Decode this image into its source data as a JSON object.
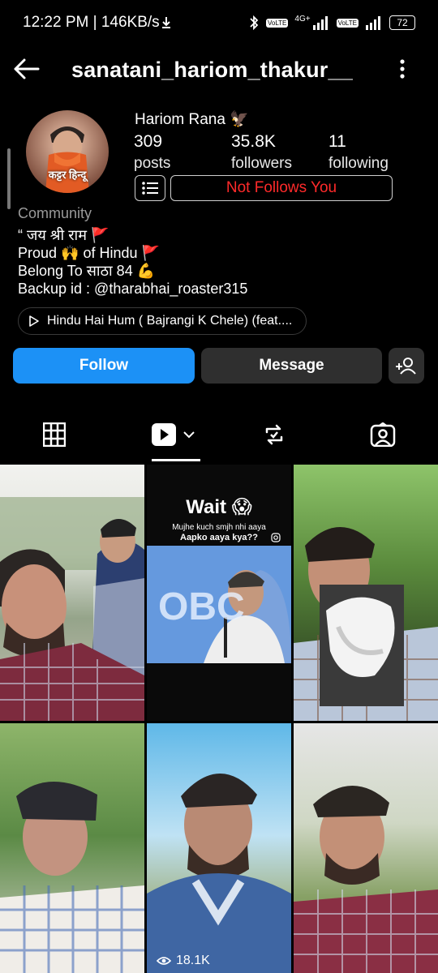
{
  "status": {
    "time_speed": "12:22 PM | 146KB/s",
    "battery": "72",
    "network": "4G+",
    "lte_tag": "Vo LTE"
  },
  "profile": {
    "username": "sanatani_hariom_thakur__",
    "display_name": "Hariom Rana 🦅",
    "avatar_caption": "कट्टर हिन्दू",
    "stats": {
      "posts": {
        "num": "309",
        "label": "posts"
      },
      "followers": {
        "num": "35.8K",
        "label": "followers"
      },
      "following": {
        "num": "11",
        "label": "following"
      }
    },
    "not_follows_label": "Not Follows You",
    "category": "Community",
    "bio": [
      "“ जय श्री राम 🚩",
      "Proud 🙌 of Hindu 🚩",
      "Belong To साठा 84 💪",
      "Backup id : @tharabhai_roaster315"
    ],
    "music": "Hindu Hai Hum ( Bajrangi K Chele) (feat...."
  },
  "actions": {
    "follow": "Follow",
    "message": "Message"
  },
  "tabs": [
    "grid",
    "reels",
    "reposts",
    "tagged"
  ],
  "grid": {
    "tile2": {
      "title": "Wait 😱",
      "line1": "Mujhe kuch smjh nhi aaya",
      "line2": "Aapko aaya kya??",
      "sign": "OBC"
    },
    "tile5_views": "18.1K"
  },
  "colors": {
    "follow": "#1c91f6",
    "not_follows": "#ff2a2a",
    "secondary_btn": "#2f2f2f"
  }
}
